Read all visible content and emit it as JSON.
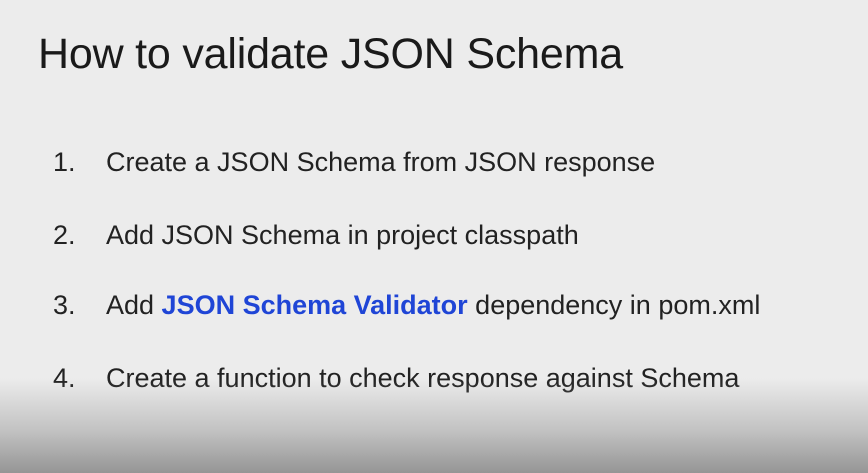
{
  "slide": {
    "title": "How to validate JSON Schema",
    "steps": [
      {
        "number": "1.",
        "text": "Create a JSON Schema from JSON response"
      },
      {
        "number": "2.",
        "text": "Add JSON Schema in project classpath"
      },
      {
        "number": "3.",
        "prefix": "Add ",
        "highlight": "JSON Schema Validator",
        "suffix": " dependency in pom.xml"
      },
      {
        "number": "4.",
        "text": "Create a function to check response against Schema"
      }
    ],
    "colors": {
      "background": "#ececec",
      "text": "#222222",
      "highlight": "#1f45d6"
    }
  }
}
